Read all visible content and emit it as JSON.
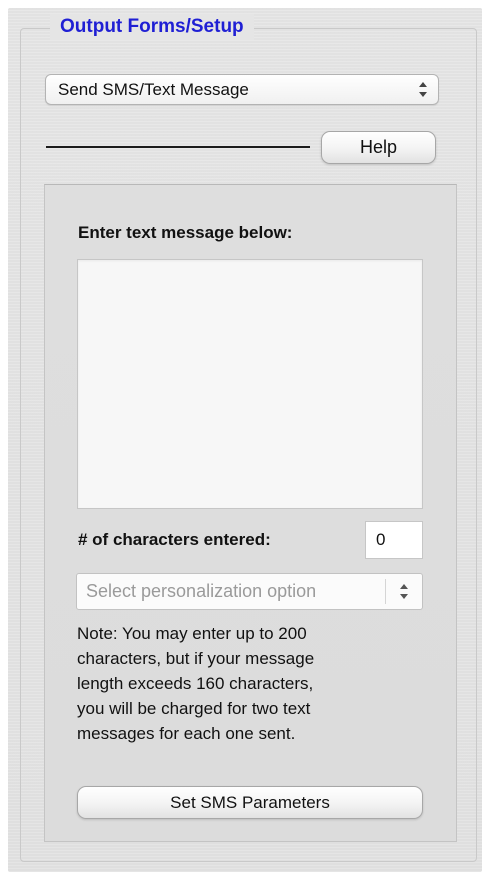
{
  "group": {
    "title": "Output Forms/Setup"
  },
  "output_select": {
    "value": "Send SMS/Text Message",
    "icon": "up-down-arrows-icon"
  },
  "help_button": {
    "label": "Help"
  },
  "sms": {
    "heading": "Enter text message below:",
    "message_value": "",
    "char_count_label": "# of characters entered:",
    "char_count_value": "0",
    "personalization_placeholder": "Select personalization option",
    "note_lines": [
      "Note: You may enter up to 200",
      "characters, but if your message",
      "length exceeds 160 characters,",
      "you will be charged for two text",
      "messages for each one sent."
    ],
    "set_params_label": "Set SMS Parameters"
  },
  "colors": {
    "title": "#1f1fd4",
    "panel": "#e4e4e4"
  }
}
